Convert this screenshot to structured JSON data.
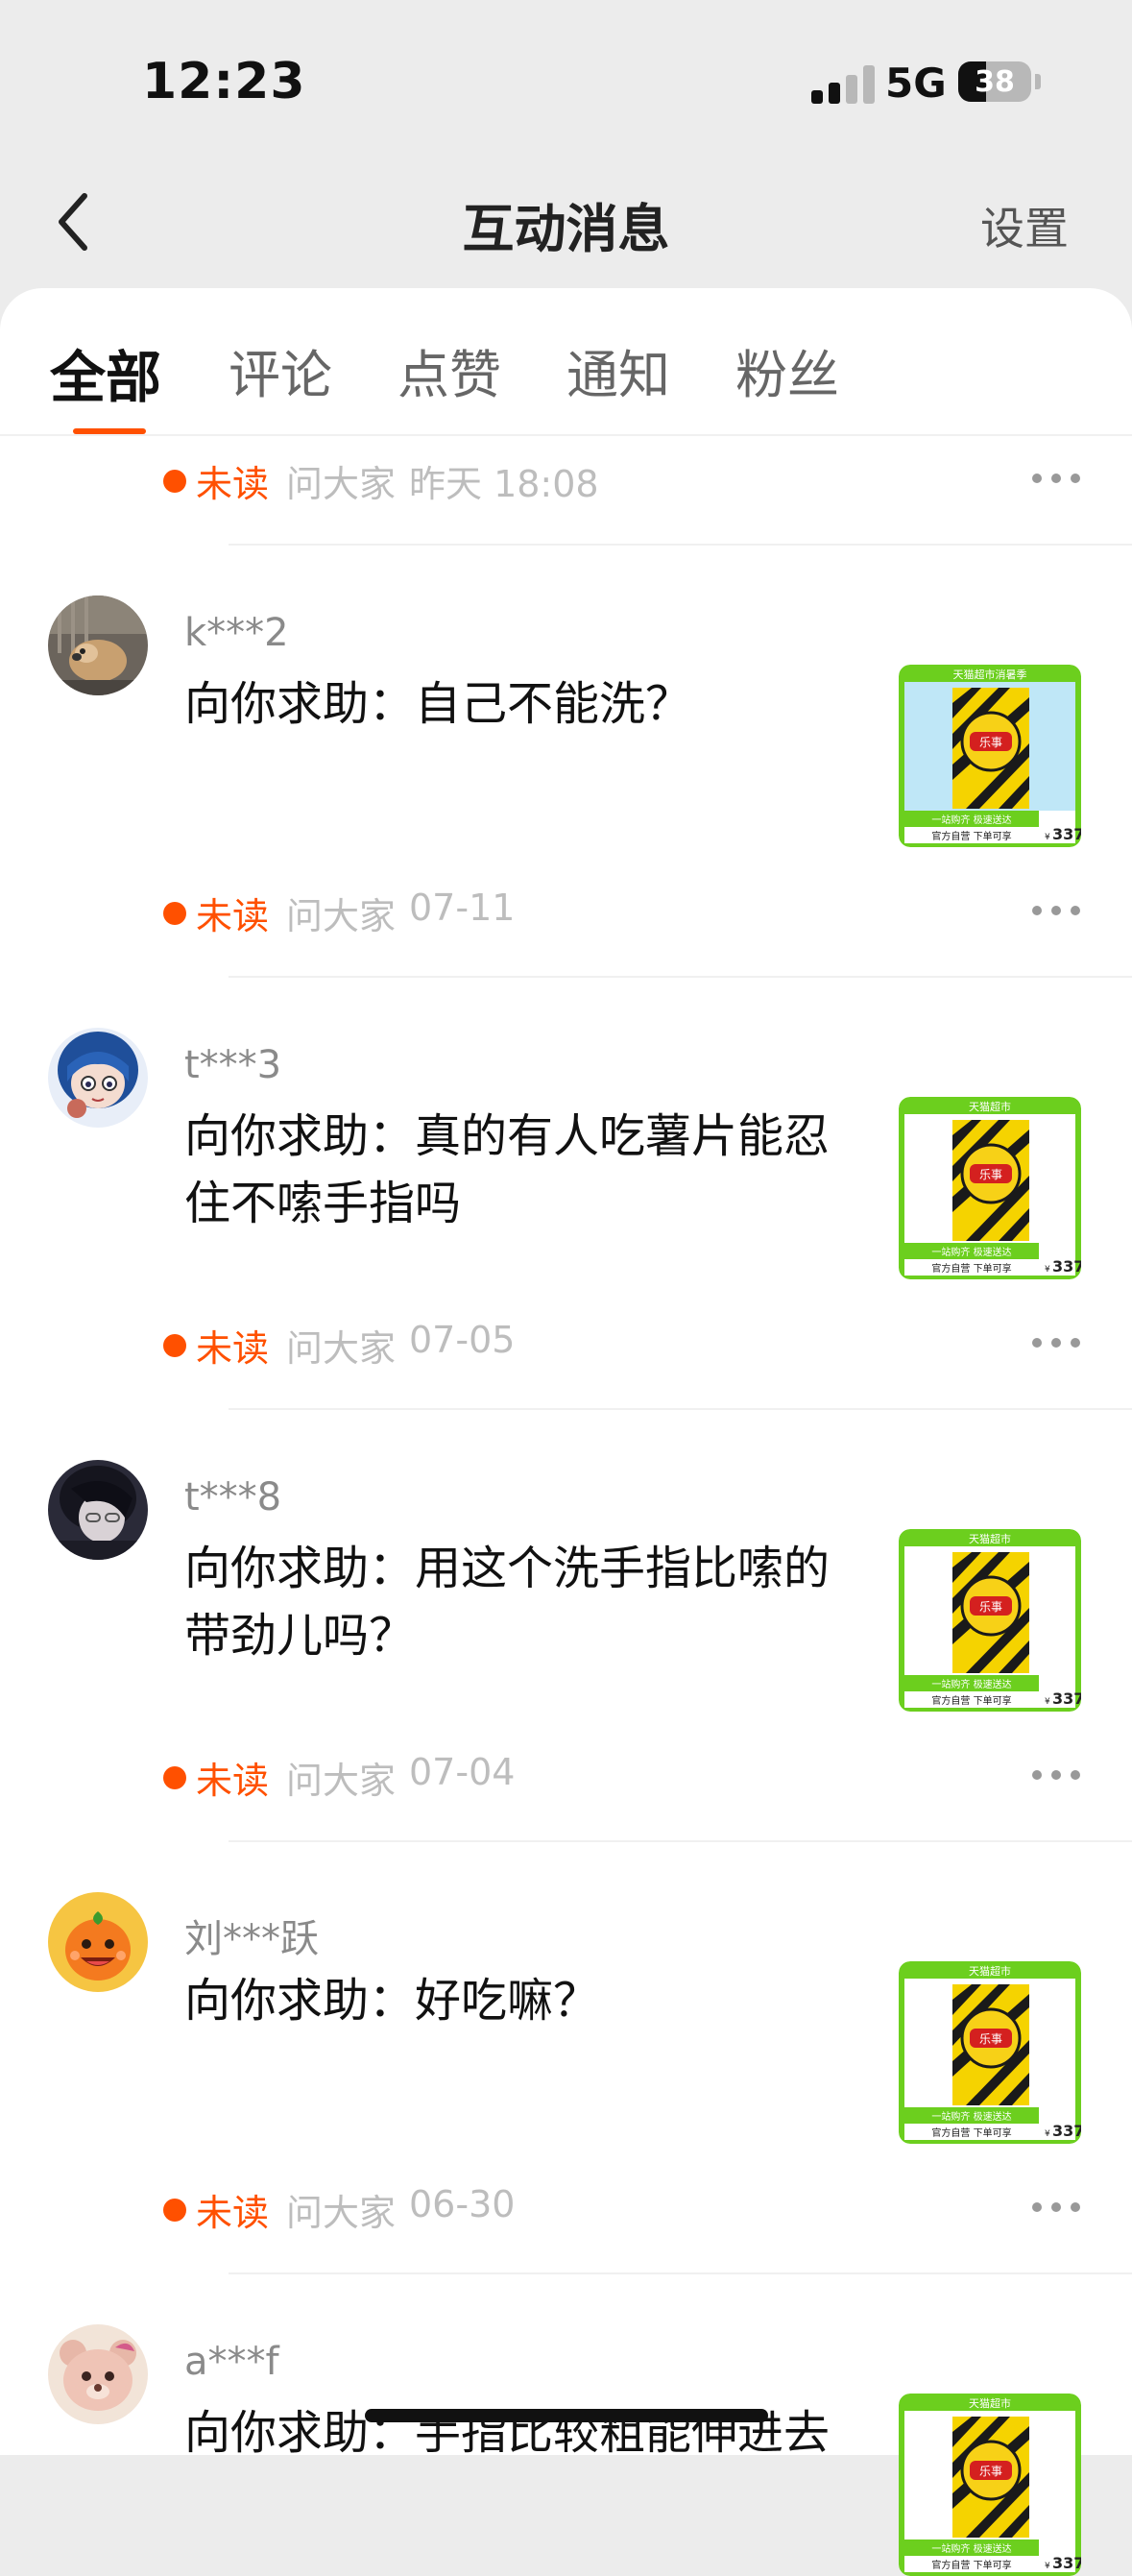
{
  "status_bar": {
    "time": "12:23",
    "network": "5G",
    "battery": "38",
    "battery_level": 0.38
  },
  "nav": {
    "title": "互动消息",
    "settings_label": "设置"
  },
  "tabs": [
    {
      "label": "全部",
      "active": true
    },
    {
      "label": "评论",
      "active": false
    },
    {
      "label": "点赞",
      "active": false
    },
    {
      "label": "通知",
      "active": false
    },
    {
      "label": "粉丝",
      "active": false
    }
  ],
  "first_meta": {
    "status": "未读",
    "source": "问大家",
    "date": "昨天 18:08"
  },
  "messages": [
    {
      "username": "k***2",
      "text": "向你求助：自己不能洗？",
      "status": "未读",
      "source": "问大家",
      "date": "07-11",
      "avatar": "dog-photo"
    },
    {
      "username": "t***3",
      "text": "向你求助：真的有人吃薯片能忍住不嗦手指吗",
      "status": "未读",
      "source": "问大家",
      "date": "07-05",
      "avatar": "anime-blue-hair"
    },
    {
      "username": "t***8",
      "text": "向你求助：用这个洗手指比嗦的带劲儿吗？",
      "status": "未读",
      "source": "问大家",
      "date": "07-04",
      "avatar": "dark-portrait"
    },
    {
      "username": "刘***跃",
      "text": "向你求助：好吃嘛？",
      "status": "未读",
      "source": "问大家",
      "date": "06-30",
      "avatar": "orange-mascot"
    },
    {
      "username": "a***f",
      "text": "向你求助：手指比较粗能伸进去",
      "status": "",
      "source": "",
      "date": "",
      "avatar": "plush-bear"
    }
  ],
  "product_thumb": {
    "top_banner_1": "天猫超市消暑季",
    "top_banner": "天猫超市",
    "brand": "乐事",
    "slogan": "一站购齐 极速送达",
    "official": "官方自营 下单可享",
    "price": "337",
    "currency": "¥"
  },
  "colors": {
    "accent": "#ff5000",
    "thumb_green": "#6ccf1e",
    "thumb_yellow": "#f5d300"
  }
}
